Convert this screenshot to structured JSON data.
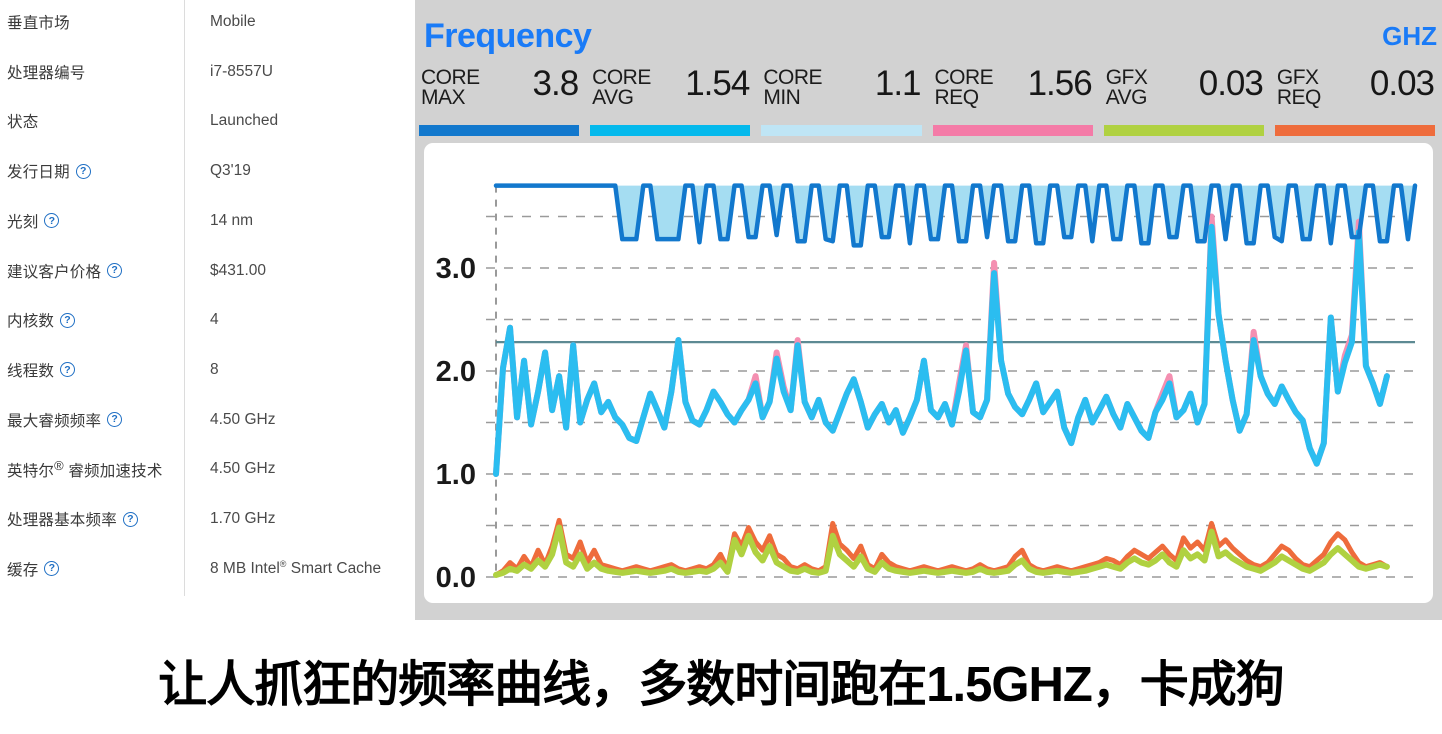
{
  "spec_table": {
    "rows": [
      {
        "label": "垂直市场",
        "help": false,
        "value": "Mobile"
      },
      {
        "label": "处理器编号",
        "help": false,
        "value": "i7-8557U"
      },
      {
        "label": "状态",
        "help": false,
        "value": "Launched"
      },
      {
        "label": "发行日期",
        "help": true,
        "value": "Q3'19"
      },
      {
        "label": "光刻",
        "help": true,
        "value": "14 nm"
      },
      {
        "label": "建议客户价格",
        "help": true,
        "value": "$431.00"
      },
      {
        "label": "内核数",
        "help": true,
        "value": "4"
      },
      {
        "label": "线程数",
        "help": true,
        "value": "8"
      },
      {
        "label": "最大睿频频率",
        "help": true,
        "value": "4.50 GHz"
      },
      {
        "label": "英特尔® 睿频加速技术",
        "help": false,
        "value": "4.50 GHz"
      },
      {
        "label": "处理器基本频率",
        "help": true,
        "value": "1.70 GHz"
      },
      {
        "label": "缓存",
        "help": true,
        "value": "8 MB Intel® Smart Cache"
      }
    ],
    "help_icon": "?"
  },
  "monitor": {
    "title": "Frequency",
    "unit": "GHZ",
    "title_color": "#1a7bf7",
    "background": "#d2d2d2",
    "stats": [
      {
        "tag_line1": "CORE",
        "tag_line2": "MAX",
        "value": "3.8",
        "bar_color": "#1278cd"
      },
      {
        "tag_line1": "CORE",
        "tag_line2": "AVG",
        "value": "1.54",
        "bar_color": "#04b9ec"
      },
      {
        "tag_line1": "CORE",
        "tag_line2": "MIN",
        "value": "1.1",
        "bar_color": "#bfe5f5"
      },
      {
        "tag_line1": "CORE",
        "tag_line2": "REQ",
        "value": "1.56",
        "bar_color": "#f47ba7"
      },
      {
        "tag_line1": "GFX",
        "tag_line2": "AVG",
        "value": "0.03",
        "bar_color": "#b0d141"
      },
      {
        "tag_line1": "GFX",
        "tag_line2": "REQ",
        "value": "0.03",
        "bar_color": "#ee6c3c"
      }
    ]
  },
  "caption": {
    "text": "让人抓狂的频率曲线，多数时间跑在1.5GHZ，卡成狗"
  },
  "chart_data": {
    "type": "area",
    "title": "Frequency",
    "ylabel": "GHZ",
    "xlabel": "",
    "ylim": [
      0,
      4.0
    ],
    "yticks": [
      0.0,
      1.0,
      2.0,
      3.0
    ],
    "ytick_labels": [
      "0.0",
      "1.0",
      "2.0",
      "3.0"
    ],
    "gridlines": [
      0.0,
      0.5,
      1.0,
      1.5,
      2.0,
      2.5,
      3.0,
      3.5
    ],
    "grid": true,
    "legend": "none",
    "reference_line": {
      "value": 2.28,
      "color": "#5d8a93",
      "label": "core base reference"
    },
    "band": {
      "name": "Core Max / Core Min band",
      "fill": "#a5ddf2"
    },
    "series": [
      {
        "name": "Core Max",
        "color": "#1278cd",
        "values": [
          3.8,
          3.8,
          3.8,
          3.8,
          3.8,
          3.8,
          3.8,
          3.8,
          3.8,
          3.8,
          3.8,
          3.8,
          3.8,
          3.8,
          3.8,
          3.8,
          3.8,
          3.8,
          3.28,
          3.28,
          3.28,
          3.8,
          3.8,
          3.28,
          3.28,
          3.28,
          3.28,
          3.8,
          3.8,
          3.25,
          3.8,
          3.8,
          3.28,
          3.28,
          3.8,
          3.8,
          3.3,
          3.3,
          3.8,
          3.8,
          3.32,
          3.8,
          3.8,
          3.26,
          3.26,
          3.8,
          3.8,
          3.28,
          3.26,
          3.8,
          3.8,
          3.22,
          3.22,
          3.8,
          3.8,
          3.3,
          3.3,
          3.8,
          3.8,
          3.24,
          3.8,
          3.8,
          3.28,
          3.28,
          3.8,
          3.8,
          3.26,
          3.26,
          3.8,
          3.8,
          3.3,
          3.8,
          3.8,
          3.26,
          3.26,
          3.8,
          3.8,
          3.24,
          3.24,
          3.8,
          3.8,
          3.3,
          3.3,
          3.8,
          3.8,
          3.26,
          3.8,
          3.8,
          3.28,
          3.28,
          3.8,
          3.8,
          3.24,
          3.24,
          3.8,
          3.8,
          3.3,
          3.3,
          3.8,
          3.8,
          3.26,
          3.26,
          3.8,
          3.8,
          3.28,
          3.8,
          3.8,
          3.24,
          3.24,
          3.8,
          3.8,
          3.3,
          3.26,
          3.8,
          3.8,
          3.28,
          3.28,
          3.8,
          3.8,
          3.24,
          3.8,
          3.8,
          3.3,
          3.3,
          3.8,
          3.8,
          3.26,
          3.26,
          3.8,
          3.8,
          3.28,
          3.8
        ]
      },
      {
        "name": "Core Avg",
        "color": "#2bbdf0",
        "values": [
          1.0,
          2.03,
          2.42,
          1.55,
          2.1,
          1.48,
          1.8,
          2.18,
          1.62,
          1.95,
          1.45,
          2.25,
          1.5,
          1.72,
          1.88,
          1.6,
          1.7,
          1.55,
          1.48,
          1.35,
          1.32,
          1.55,
          1.78,
          1.62,
          1.45,
          1.8,
          2.3,
          1.7,
          1.52,
          1.48,
          1.62,
          1.8,
          1.7,
          1.58,
          1.5,
          1.62,
          1.72,
          1.88,
          1.55,
          1.7,
          2.12,
          1.8,
          1.62,
          2.25,
          1.7,
          1.55,
          1.72,
          1.5,
          1.42,
          1.6,
          1.78,
          1.92,
          1.7,
          1.45,
          1.58,
          1.68,
          1.5,
          1.62,
          1.4,
          1.55,
          1.72,
          2.1,
          1.62,
          1.55,
          1.68,
          1.48,
          1.8,
          2.2,
          1.6,
          1.55,
          1.72,
          2.95,
          2.1,
          1.78,
          1.65,
          1.58,
          1.72,
          1.88,
          1.6,
          1.7,
          1.8,
          1.45,
          1.3,
          1.55,
          1.72,
          1.5,
          1.62,
          1.75,
          1.58,
          1.45,
          1.68,
          1.55,
          1.42,
          1.35,
          1.6,
          1.72,
          1.88,
          1.55,
          1.62,
          1.78,
          1.5,
          1.68,
          3.4,
          2.55,
          2.1,
          1.72,
          1.42,
          1.58,
          2.3,
          1.95,
          1.78,
          1.68,
          1.85,
          1.72,
          1.6,
          1.52,
          1.25,
          1.1,
          1.3,
          2.52,
          1.8,
          2.08,
          2.28,
          3.35,
          2.05,
          1.88,
          1.68,
          1.95
        ]
      },
      {
        "name": "Core Req",
        "color": "#f48fb1",
        "values": [
          1.0,
          2.03,
          2.42,
          1.55,
          2.1,
          1.48,
          1.8,
          2.18,
          1.62,
          1.95,
          1.45,
          2.25,
          1.5,
          1.72,
          1.88,
          1.6,
          1.7,
          1.55,
          1.48,
          1.35,
          1.32,
          1.55,
          1.78,
          1.62,
          1.45,
          1.8,
          2.3,
          1.7,
          1.52,
          1.48,
          1.62,
          1.8,
          1.7,
          1.58,
          1.5,
          1.62,
          1.72,
          1.95,
          1.55,
          1.7,
          2.18,
          1.85,
          1.62,
          2.3,
          1.7,
          1.55,
          1.72,
          1.5,
          1.42,
          1.6,
          1.78,
          1.92,
          1.7,
          1.45,
          1.58,
          1.68,
          1.5,
          1.62,
          1.4,
          1.55,
          1.72,
          2.1,
          1.62,
          1.55,
          1.68,
          1.48,
          1.88,
          2.25,
          1.6,
          1.55,
          1.72,
          3.05,
          2.1,
          1.78,
          1.65,
          1.58,
          1.72,
          1.88,
          1.6,
          1.7,
          1.8,
          1.45,
          1.3,
          1.55,
          1.72,
          1.5,
          1.62,
          1.75,
          1.58,
          1.45,
          1.68,
          1.55,
          1.42,
          1.35,
          1.6,
          1.78,
          1.95,
          1.55,
          1.62,
          1.78,
          1.5,
          1.68,
          3.5,
          2.55,
          2.1,
          1.72,
          1.42,
          1.58,
          2.38,
          1.95,
          1.78,
          1.68,
          1.85,
          1.72,
          1.6,
          1.52,
          1.25,
          1.1,
          1.3,
          2.52,
          1.8,
          2.15,
          2.35,
          3.45,
          2.05,
          1.88,
          1.68,
          1.95
        ]
      },
      {
        "name": "Core Min",
        "color": "#a5ddf2",
        "values": [
          1.1,
          1.1,
          1.1,
          1.1,
          0.72,
          1.1,
          1.1,
          1.1,
          1.1,
          1.1,
          0.88,
          1.1,
          1.1,
          1.1,
          1.1,
          1.1,
          1.1,
          1.1,
          1.1,
          0.78,
          1.1,
          1.1,
          1.1,
          1.1,
          1.1,
          1.1,
          1.1,
          1.1,
          1.1,
          1.1,
          1.1,
          0.62,
          1.1,
          1.1,
          1.1,
          1.1,
          1.1,
          1.1,
          1.1,
          0.7,
          1.1,
          1.1,
          1.1,
          1.1,
          1.1,
          1.1,
          0.95,
          1.1,
          1.1,
          1.1,
          1.1,
          1.1,
          1.1,
          1.1,
          0.85,
          1.1,
          1.1,
          1.1,
          1.1,
          1.1,
          1.1,
          1.1,
          1.1,
          0.6,
          1.1,
          1.1,
          1.1,
          1.1,
          1.1,
          1.1,
          1.1,
          1.1,
          1.1,
          1.1,
          1.1,
          1.1,
          1.1,
          1.1,
          1.1,
          1.1,
          1.1,
          1.1,
          1.1,
          1.1,
          1.1,
          1.1,
          1.1,
          1.1,
          1.1,
          1.1,
          1.1,
          1.1,
          1.1,
          1.1,
          1.1,
          1.1,
          1.1,
          1.1,
          1.1,
          1.1,
          1.1,
          1.1,
          1.1,
          1.1,
          1.1,
          1.1,
          0.72,
          1.1,
          1.1,
          1.1,
          1.1,
          1.1,
          1.1,
          1.1,
          1.1,
          1.1,
          1.1,
          1.1,
          1.1,
          1.1,
          1.1,
          1.1,
          1.1,
          1.1,
          1.1,
          1.1,
          1.1,
          1.1
        ]
      },
      {
        "name": "GFX Req",
        "color": "#ee6c3c",
        "values": [
          0.02,
          0.06,
          0.14,
          0.08,
          0.2,
          0.1,
          0.26,
          0.12,
          0.3,
          0.55,
          0.22,
          0.18,
          0.34,
          0.14,
          0.26,
          0.12,
          0.1,
          0.08,
          0.06,
          0.08,
          0.1,
          0.08,
          0.06,
          0.08,
          0.1,
          0.12,
          0.08,
          0.06,
          0.08,
          0.1,
          0.08,
          0.12,
          0.22,
          0.08,
          0.42,
          0.3,
          0.48,
          0.34,
          0.26,
          0.4,
          0.22,
          0.18,
          0.1,
          0.08,
          0.12,
          0.08,
          0.06,
          0.1,
          0.52,
          0.32,
          0.26,
          0.18,
          0.3,
          0.12,
          0.08,
          0.22,
          0.14,
          0.1,
          0.08,
          0.06,
          0.08,
          0.1,
          0.08,
          0.06,
          0.08,
          0.1,
          0.08,
          0.06,
          0.08,
          0.12,
          0.08,
          0.06,
          0.08,
          0.1,
          0.2,
          0.26,
          0.12,
          0.08,
          0.06,
          0.08,
          0.1,
          0.08,
          0.06,
          0.08,
          0.1,
          0.12,
          0.14,
          0.18,
          0.16,
          0.12,
          0.2,
          0.26,
          0.22,
          0.18,
          0.24,
          0.3,
          0.22,
          0.16,
          0.38,
          0.28,
          0.34,
          0.26,
          0.52,
          0.3,
          0.36,
          0.28,
          0.22,
          0.16,
          0.12,
          0.1,
          0.14,
          0.22,
          0.3,
          0.26,
          0.18,
          0.12,
          0.1,
          0.16,
          0.22,
          0.34,
          0.42,
          0.36,
          0.24,
          0.14,
          0.1,
          0.12,
          0.14,
          0.1
        ]
      },
      {
        "name": "GFX Avg",
        "color": "#b0d141",
        "values": [
          0.02,
          0.04,
          0.08,
          0.06,
          0.12,
          0.08,
          0.16,
          0.1,
          0.22,
          0.48,
          0.14,
          0.1,
          0.22,
          0.08,
          0.14,
          0.08,
          0.06,
          0.05,
          0.04,
          0.05,
          0.06,
          0.05,
          0.04,
          0.05,
          0.06,
          0.08,
          0.05,
          0.04,
          0.05,
          0.06,
          0.05,
          0.08,
          0.14,
          0.05,
          0.36,
          0.22,
          0.4,
          0.24,
          0.16,
          0.3,
          0.14,
          0.1,
          0.06,
          0.05,
          0.08,
          0.05,
          0.04,
          0.06,
          0.4,
          0.22,
          0.16,
          0.1,
          0.2,
          0.08,
          0.05,
          0.14,
          0.08,
          0.06,
          0.05,
          0.04,
          0.05,
          0.06,
          0.05,
          0.04,
          0.05,
          0.06,
          0.05,
          0.04,
          0.05,
          0.08,
          0.05,
          0.04,
          0.05,
          0.06,
          0.12,
          0.16,
          0.08,
          0.05,
          0.04,
          0.05,
          0.06,
          0.05,
          0.04,
          0.05,
          0.06,
          0.08,
          0.1,
          0.12,
          0.1,
          0.08,
          0.14,
          0.18,
          0.14,
          0.12,
          0.16,
          0.22,
          0.14,
          0.1,
          0.26,
          0.18,
          0.22,
          0.16,
          0.44,
          0.2,
          0.24,
          0.18,
          0.14,
          0.1,
          0.08,
          0.06,
          0.1,
          0.14,
          0.2,
          0.16,
          0.12,
          0.08,
          0.06,
          0.1,
          0.14,
          0.22,
          0.28,
          0.22,
          0.16,
          0.1,
          0.08,
          0.1,
          0.12,
          0.1
        ]
      }
    ]
  }
}
